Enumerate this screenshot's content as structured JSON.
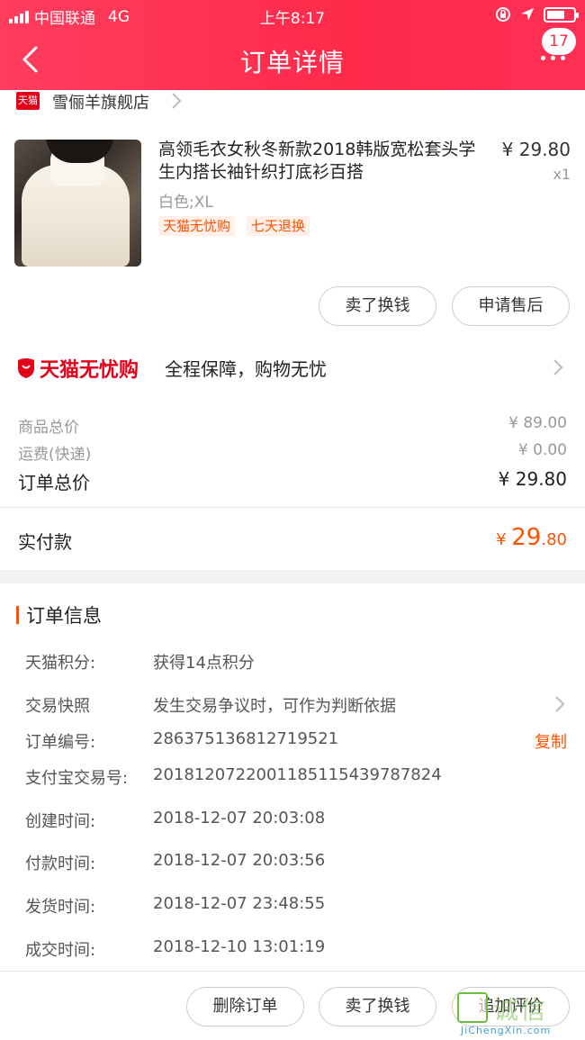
{
  "status_bar": {
    "carrier": "中国联通",
    "network": "4G",
    "time": "上午8:17"
  },
  "nav": {
    "title": "订单详情",
    "badge_count": "17"
  },
  "shop": {
    "logo_text": "天猫",
    "name": "雪俪羊旗舰店"
  },
  "product": {
    "title": "高领毛衣女秋冬新款2018韩版宽松套头学生内搭长袖针织打底衫百搭",
    "price": "¥ 29.80",
    "quantity": "x1",
    "sku": "白色;XL",
    "tags": [
      "天猫无忧购",
      "七天退换"
    ],
    "buttons": [
      "卖了换钱",
      "申请售后"
    ]
  },
  "guarantee": {
    "logo": "天猫无忧购",
    "text": "全程保障，购物无忧"
  },
  "price_summary": {
    "goods_total_label": "商品总价",
    "goods_total_value": "¥ 89.00",
    "shipping_label": "运费(快递)",
    "shipping_value": "¥ 0.00",
    "order_total_label": "订单总价",
    "order_total_value": "¥ 29.80"
  },
  "paid": {
    "label": "实付款",
    "currency": "¥ ",
    "integer": "29",
    "decimal": ".80"
  },
  "order_info": {
    "heading": "订单信息",
    "rows": [
      {
        "label": "天猫积分:",
        "value": "获得14点积分"
      },
      {
        "label": "交易快照",
        "value": "发生交易争议时，可作为判断依据"
      },
      {
        "label": "订单编号:",
        "value": "286375136812719521",
        "action": "复制"
      },
      {
        "label": "支付宝交易号:",
        "value": "2018120722001185115439787824"
      },
      {
        "label": "创建时间:",
        "value": "2018-12-07 20:03:08"
      },
      {
        "label": "付款时间:",
        "value": "2018-12-07 20:03:56"
      },
      {
        "label": "发货时间:",
        "value": "2018-12-07 23:48:55"
      },
      {
        "label": "成交时间:",
        "value": "2018-12-10 13:01:19"
      }
    ]
  },
  "bottom_buttons": [
    "删除订单",
    "卖了换钱",
    "追加评价"
  ],
  "watermark": {
    "text": "诚信",
    "url": "JiChengXin.com"
  },
  "colors": {
    "header_red": "#ff2a4a",
    "accent_orange": "#ff5000",
    "tmall_red": "#e5001a"
  }
}
